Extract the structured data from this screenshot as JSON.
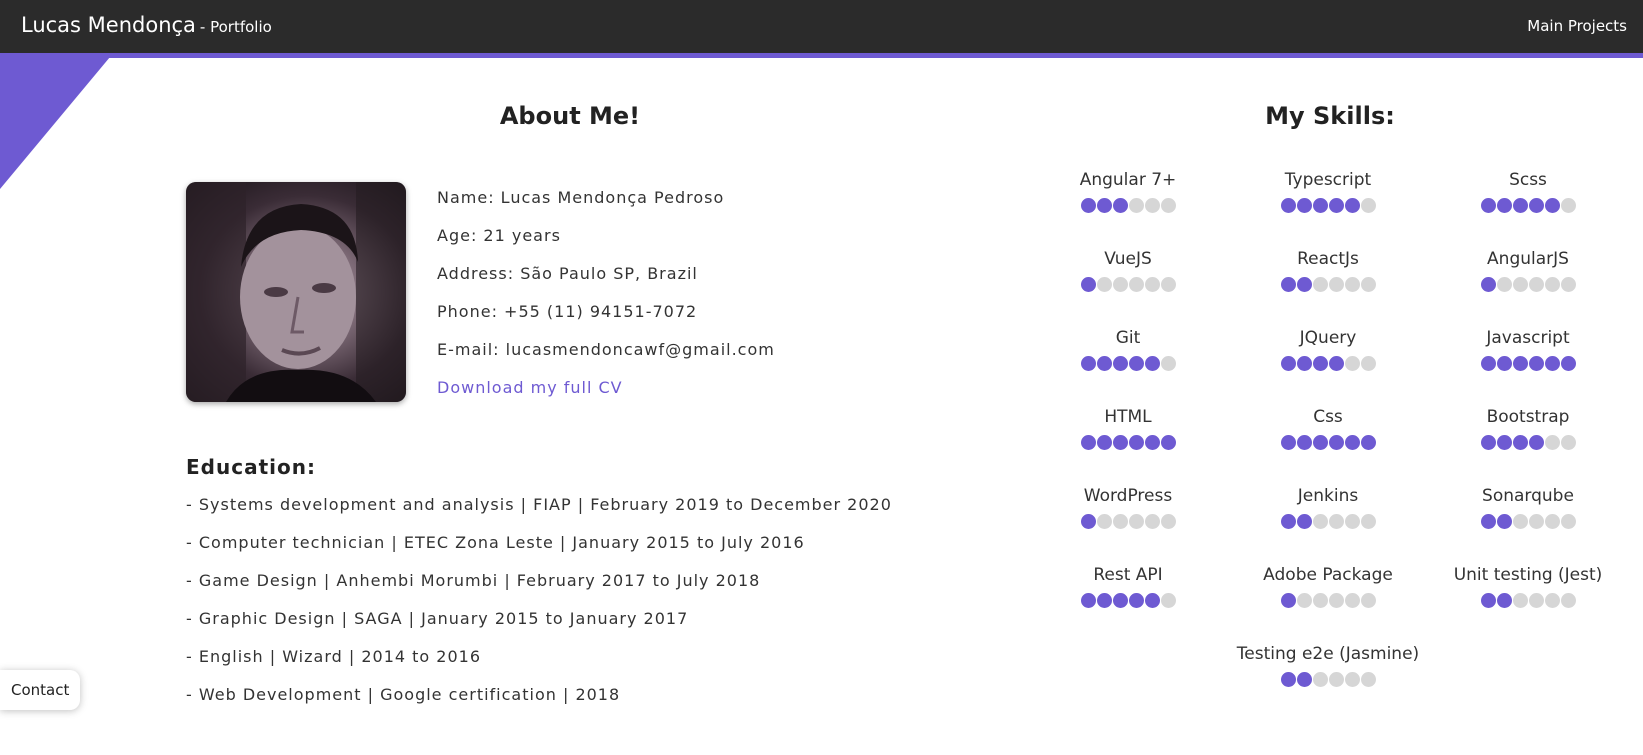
{
  "header": {
    "brand_name": "Lucas Mendonça",
    "brand_sub": "- Portfolio",
    "nav_link": "Main Projects"
  },
  "colors": {
    "accent": "#6e5ad2",
    "topbar": "#2b2b2b",
    "dot_off": "#d6d6d6"
  },
  "about": {
    "title": "About Me!",
    "photo_icon": "profile-photo",
    "info": [
      "Name: Lucas Mendonça Pedroso",
      "Age: 21 years",
      "Address: São Paulo SP, Brazil",
      "Phone: +55 (11) 94151-7072",
      "E-mail: lucasmendoncawf@gmail.com"
    ],
    "cv_link": "Download my full CV"
  },
  "education": {
    "title": "Education:",
    "items": [
      "- Systems development and analysis | FIAP | February 2019 to December 2020",
      "- Computer technician | ETEC Zona Leste | January 2015 to July 2016",
      "- Game Design | Anhembi Morumbi | February 2017 to July 2018",
      "- Graphic Design | SAGA | January 2015 to January 2017",
      "- English | Wizard | 2014 to 2016",
      "- Web Development | Google certification | 2018"
    ]
  },
  "skills": {
    "title": "My Skills:",
    "max_level": 6,
    "items": [
      {
        "name": "Angular 7+",
        "level": 3
      },
      {
        "name": "Typescript",
        "level": 5
      },
      {
        "name": "Scss",
        "level": 5
      },
      {
        "name": "VueJS",
        "level": 1
      },
      {
        "name": "ReactJs",
        "level": 2
      },
      {
        "name": "AngularJS",
        "level": 1
      },
      {
        "name": "Git",
        "level": 5
      },
      {
        "name": "JQuery",
        "level": 4
      },
      {
        "name": "Javascript",
        "level": 6
      },
      {
        "name": "HTML",
        "level": 6
      },
      {
        "name": "Css",
        "level": 6
      },
      {
        "name": "Bootstrap",
        "level": 4
      },
      {
        "name": "WordPress",
        "level": 1
      },
      {
        "name": "Jenkins",
        "level": 2
      },
      {
        "name": "Sonarqube",
        "level": 2
      },
      {
        "name": "Rest API",
        "level": 5
      },
      {
        "name": "Adobe Package",
        "level": 1
      },
      {
        "name": "Unit testing (Jest)",
        "level": 2
      },
      {
        "name": "Testing e2e (Jasmine)",
        "level": 2
      }
    ]
  },
  "contact": {
    "label": "Contact"
  }
}
